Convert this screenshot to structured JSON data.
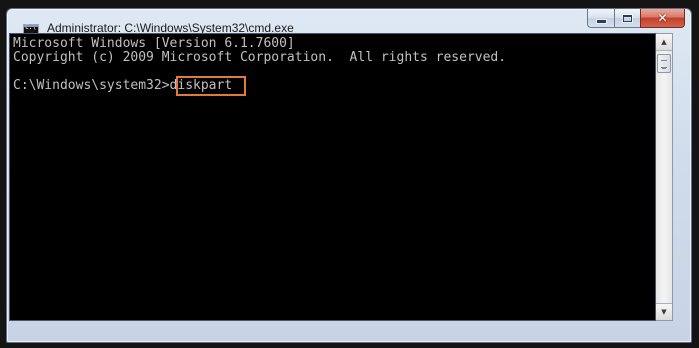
{
  "window": {
    "title": "Administrator: C:\\Windows\\System32\\cmd.exe",
    "icon": "cmd-console-icon"
  },
  "caption_buttons": {
    "minimize_icon": "minimize-icon",
    "maximize_icon": "maximize-icon",
    "close_glyph": "✕"
  },
  "console": {
    "line1": "Microsoft Windows [Version 6.1.7600]",
    "line2": "Copyright (c) 2009 Microsoft Corporation.  All rights reserved.",
    "prompt": "C:\\Windows\\system32>",
    "command": "diskpart",
    "text_color": "#c0c0c0",
    "background_color": "#000000",
    "highlight_color": "#e07b39"
  },
  "scrollbar": {
    "up_glyph": "▲",
    "down_glyph": "▼"
  }
}
